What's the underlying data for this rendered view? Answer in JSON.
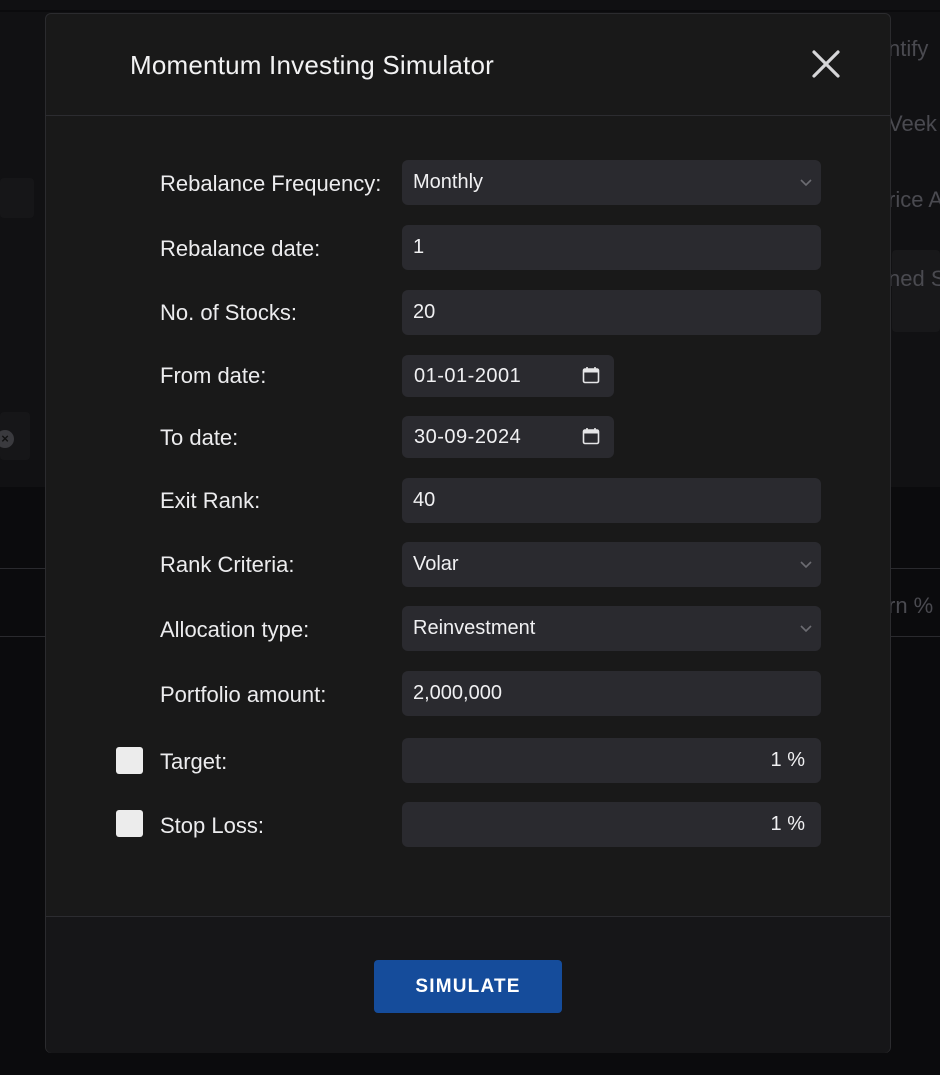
{
  "modal": {
    "title": "Momentum Investing Simulator"
  },
  "background": {
    "fragments": [
      "ntify",
      "Veek",
      "rice A",
      "ned S",
      "rn %"
    ]
  },
  "form": {
    "rebalance_frequency": {
      "label": "Rebalance Frequency:",
      "value": "Monthly"
    },
    "rebalance_date": {
      "label": "Rebalance date:",
      "value": "1"
    },
    "num_stocks": {
      "label": "No. of Stocks:",
      "value": "20"
    },
    "from_date": {
      "label": "From date:",
      "value": "01-01-2001"
    },
    "to_date": {
      "label": "To date:",
      "value": "30-09-2024"
    },
    "exit_rank": {
      "label": "Exit Rank:",
      "value": "40"
    },
    "rank_criteria": {
      "label": "Rank Criteria:",
      "value": "Volar"
    },
    "allocation_type": {
      "label": "Allocation type:",
      "value": "Reinvestment"
    },
    "portfolio_amount": {
      "label": "Portfolio amount:",
      "value": "2,000,000"
    },
    "target": {
      "label": "Target:",
      "value": "1 %",
      "checked": false
    },
    "stop_loss": {
      "label": "Stop Loss:",
      "value": "1 %",
      "checked": false
    }
  },
  "footer": {
    "simulate_label": "SIMULATE"
  },
  "colors": {
    "modal_bg": "#191919",
    "field_bg": "#2a2a2f",
    "button_bg": "#154c9b"
  },
  "icons": {
    "close": "close-icon",
    "chevron": "chevron-down-icon",
    "calendar": "calendar-icon"
  }
}
